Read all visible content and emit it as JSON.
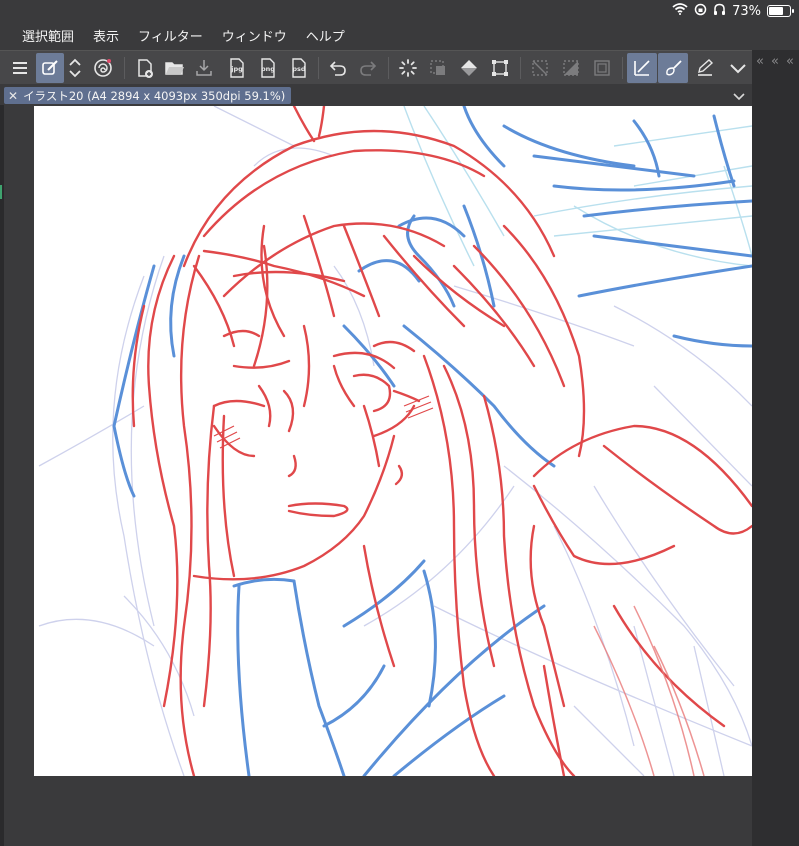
{
  "status": {
    "battery_percent": 73,
    "battery_label": "73%"
  },
  "menu": {
    "items": [
      "選択範囲",
      "表示",
      "フィルター",
      "ウィンドウ",
      "ヘルプ"
    ]
  },
  "toolbar": {
    "icons": [
      "menu-icon",
      "quick-access-icon",
      "swirl-icon",
      "new-file-icon",
      "open-folder-icon",
      "save-icon",
      "export-jpg-icon",
      "export-png-icon",
      "export-psd-icon",
      "undo-icon",
      "redo-icon",
      "loading-icon",
      "deselect-icon",
      "fill-icon",
      "transform-icon",
      "clear-selection-icon",
      "invert-selection-icon",
      "frame-icon",
      "ruler-icon",
      "brush-icon",
      "pen-icon",
      "more-icon"
    ],
    "jpg_label": "jpg",
    "png_label": "png",
    "psd_label": "psd"
  },
  "tab": {
    "title": "イラスト20 (A4 2894 x 4093px 350dpi 59.1%)"
  },
  "colors": {
    "background": "#3a3a3c",
    "toolbar": "#474749",
    "active_tool": "#6d7c98",
    "sketch_red": "#e0484a",
    "sketch_blue": "#5a90d8",
    "sketch_light_blue": "#b9e0ee",
    "sketch_lavender": "#c9cdea"
  }
}
